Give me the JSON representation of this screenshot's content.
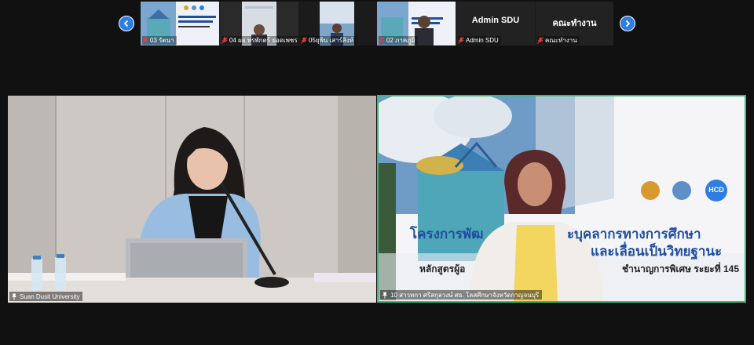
{
  "strip": {
    "prev_label": "‹",
    "next_label": "›",
    "thumbnails": [
      {
        "name": "03 รัตนา"
      },
      {
        "name": "04 ผอ.พรพักตร์ ยอดเพชร"
      },
      {
        "name": "05ยุพิน เสาร์สิงห์"
      },
      {
        "name": "02 ภาคภูมิ"
      },
      {
        "name": "Admin SDU",
        "display": "Admin SDU"
      },
      {
        "name": "คณะทำงาน",
        "display": "คณะทำงาน"
      }
    ]
  },
  "main": {
    "left_tile": {
      "name": "Suan Dusit University"
    },
    "right_tile": {
      "name": "10 สาวทกา ศรีสกุลวงษ์ ศธ. โลสศึกษาจังหวัดกาญจนบุรี",
      "banner": {
        "title_left": "โครงการพัฒ",
        "title_right": "ะบุคลากรทางการศึกษา",
        "title_line2": "และเลื่อนเป็นวิทยฐานะ",
        "subtitle_left": "หลักสูตรผู้อ",
        "subtitle_right": "ชำนาญการพิเศษ ระยะที่ 145",
        "logo_text": "HCD"
      }
    }
  },
  "colors": {
    "accent": "#2f7de1",
    "active_border": "#3fb77a",
    "banner_text": "#1f4fa0"
  }
}
